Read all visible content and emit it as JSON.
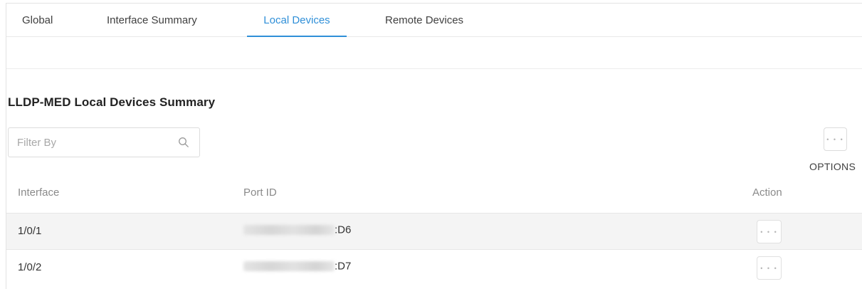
{
  "tabs": [
    {
      "label": "Global"
    },
    {
      "label": "Interface Summary"
    },
    {
      "label": "Local Devices",
      "active": true
    },
    {
      "label": "Remote Devices"
    }
  ],
  "accent_color": "#2f8fd8",
  "section": {
    "title": "LLDP-MED Local Devices Summary"
  },
  "filter": {
    "placeholder": "Filter By",
    "value": "",
    "icon": "search-icon"
  },
  "options": {
    "icon": "more-horizontal-icon",
    "label": "OPTIONS"
  },
  "table": {
    "columns": [
      "Interface",
      "Port ID",
      "Action"
    ],
    "rows": [
      {
        "interface": "1/0/1",
        "port_id_visible": ":D6",
        "action_icon": "more-horizontal-icon"
      },
      {
        "interface": "1/0/2",
        "port_id_visible": ":D7",
        "action_icon": "more-horizontal-icon"
      }
    ]
  },
  "dots_glyph": "• • •"
}
